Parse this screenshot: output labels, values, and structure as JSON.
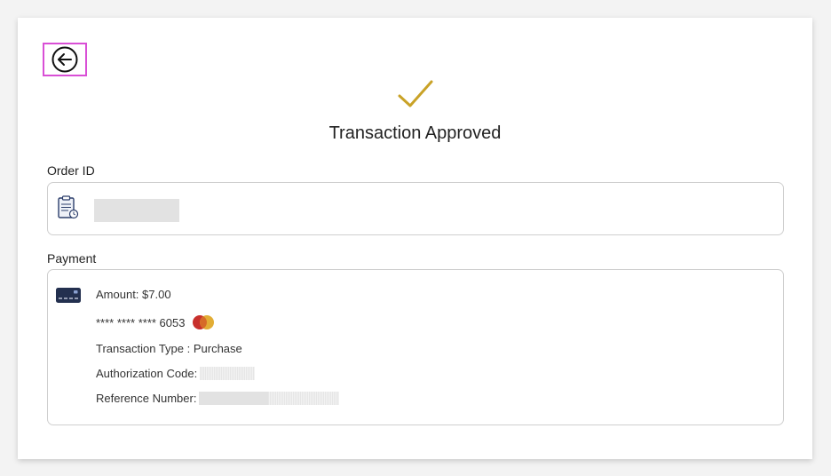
{
  "header": {
    "back_icon": "arrow-left-circle-icon",
    "status_icon": "checkmark-icon",
    "title": "Transaction Approved"
  },
  "order": {
    "label": "Order ID",
    "icon": "clipboard-clock-icon"
  },
  "payment": {
    "label": "Payment",
    "icon": "credit-card-icon",
    "amount": "Amount: $7.00",
    "card_number": "**** **** **** 6053",
    "card_brand_icon": "mastercard-icon",
    "transaction_type": "Transaction Type : Purchase",
    "authorization_label": "Authorization Code:",
    "reference_label": "Reference Number:"
  },
  "colors": {
    "accent_gold": "#c9a227",
    "highlight_border": "#d94fd6",
    "mastercard_red": "#c8302c",
    "mastercard_yellow": "#e0a92a"
  }
}
